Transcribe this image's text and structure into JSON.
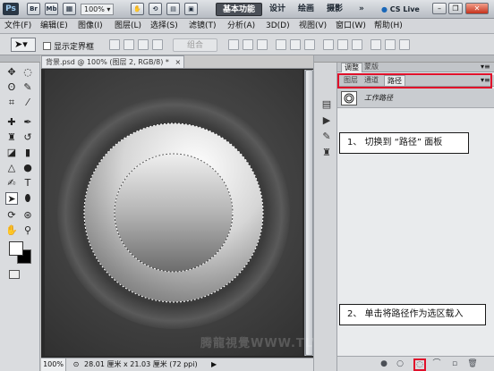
{
  "appbar": {
    "logo": "Ps",
    "bridge_icon": "Br",
    "minibridge_icon": "Mb",
    "zoom": "100%",
    "workspaces": [
      "基本功能",
      "设计",
      "绘画",
      "摄影"
    ],
    "more": "»",
    "cs_live": "CS Live"
  },
  "menu": [
    "文件(F)",
    "编辑(E)",
    "图像(I)",
    "图层(L)",
    "选择(S)",
    "滤镜(T)",
    "分析(A)",
    "3D(D)",
    "视图(V)",
    "窗口(W)",
    "帮助(H)"
  ],
  "options": {
    "show_bbox": "显示定界框",
    "combine": "组合"
  },
  "document": {
    "tab": "背景.psd @ 100% (图层 2, RGB/8) *",
    "zoom": "100%",
    "dims": "28.01 厘米 x 21.03 厘米 (72 ppi)"
  },
  "panels": {
    "top_tabs": [
      "调整",
      "蒙版"
    ],
    "bottom_tabs": [
      "图层",
      "通道",
      "路径"
    ],
    "active_tab": "路径",
    "path_item": "工作路径"
  },
  "callouts": {
    "step1": "1、 切换到 “路径” 面板",
    "step2": "2、 单击将路径作为选区载入"
  },
  "watermark": "腾龍視覺WWW.TLVI.NET",
  "colors": {
    "highlight_red": "#e0102a",
    "workspace_active": "#4a4f57"
  },
  "icons": {
    "panel_buttons": [
      "fill-path-icon",
      "stroke-path-icon",
      "load-selection-icon",
      "make-work-path-icon",
      "new-path-icon",
      "delete-path-icon"
    ]
  }
}
